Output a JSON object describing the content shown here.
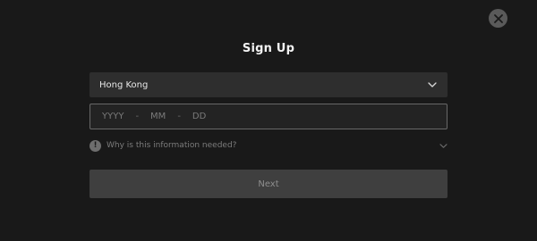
{
  "dialog": {
    "title": "Sign Up",
    "close_icon": "close-icon"
  },
  "country": {
    "value": "Hong Kong",
    "icon": "chevron-down-icon"
  },
  "birthdate": {
    "year_placeholder": "YYYY",
    "month_placeholder": "MM",
    "day_placeholder": "DD",
    "separator": "-"
  },
  "info": {
    "badge": "!",
    "text": "Why is this information needed?",
    "icon": "chevron-down-icon"
  },
  "next": {
    "label": "Next"
  },
  "colors": {
    "background": "#191919",
    "field": "#2e2e2e",
    "button_disabled": "#3f3f3f",
    "text": "#f2f2f2"
  }
}
